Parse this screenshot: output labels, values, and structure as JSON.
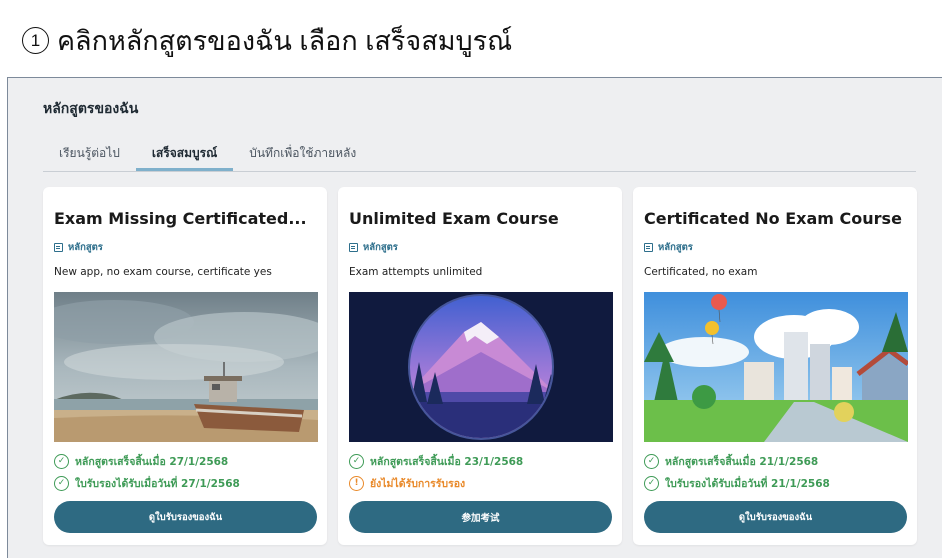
{
  "instruction": {
    "step_number": "1",
    "text": "คลิกหลักสูตรของฉัน เลือก เสร็จสมบูรณ์"
  },
  "section_title": "หลักสูตรของฉัน",
  "tabs": [
    {
      "label": "เรียนรู้ต่อไป",
      "active": false
    },
    {
      "label": "เสร็จสมบูรณ์",
      "active": true
    },
    {
      "label": "บันทึกเพื่อใช้ภายหลัง",
      "active": false
    }
  ],
  "colors": {
    "accent": "#2e6a82",
    "tab_underline": "#7fb0cb",
    "success": "#3f9b57",
    "warning": "#e98a2b",
    "type_label": "#2e6f8c"
  },
  "cards": [
    {
      "title": "Exam Missing Certificated...",
      "type_icon": "book-icon",
      "type_label": "หลักสูตร",
      "description": "New app, no exam course, certificate yes",
      "image": "beach-boat-illustration",
      "status1": {
        "icon": "check-circle-icon",
        "text": "หลักสูตรเสร็จสิ้นเมื่อ 27/1/2568"
      },
      "status2": {
        "icon": "check-circle-icon",
        "text": "ใบรับรองได้รับเมื่อวันที่ 27/1/2568"
      },
      "button_label": "ดูใบรับรองของฉัน"
    },
    {
      "title": "Unlimited Exam Course",
      "type_icon": "book-icon",
      "type_label": "หลักสูตร",
      "description": "Exam attempts unlimited",
      "image": "mountain-circle-illustration",
      "status1": {
        "icon": "check-circle-icon",
        "text": "หลักสูตรเสร็จสิ้นเมื่อ 23/1/2568"
      },
      "status2": {
        "icon": "alert-circle-icon",
        "text": "ยังไม่ได้รับการรับรอง"
      },
      "button_label": "参加考试"
    },
    {
      "title": "Certificated No Exam Course",
      "type_icon": "book-icon",
      "type_label": "หลักสูตร",
      "description": "Certificated, no exam",
      "image": "city-balloons-illustration",
      "status1": {
        "icon": "check-circle-icon",
        "text": "หลักสูตรเสร็จสิ้นเมื่อ 21/1/2568"
      },
      "status2": {
        "icon": "check-circle-icon",
        "text": "ใบรับรองได้รับเมื่อวันที่ 21/1/2568"
      },
      "button_label": "ดูใบรับรองของฉัน"
    }
  ]
}
